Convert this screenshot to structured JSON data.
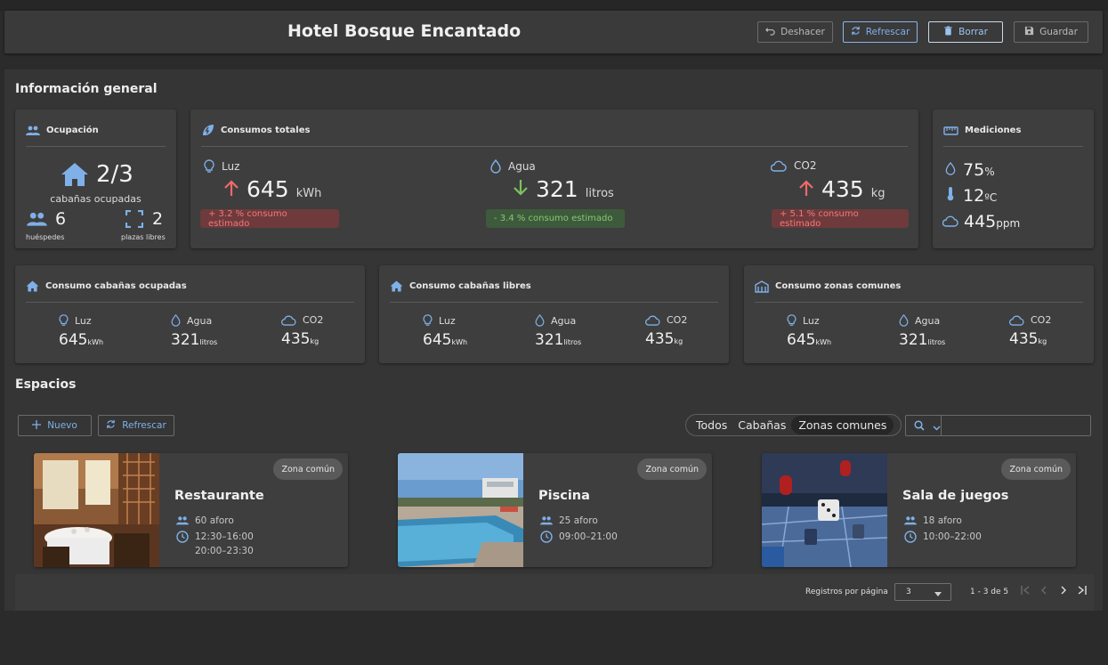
{
  "header": {
    "title": "Hotel Bosque Encantado",
    "buttons": {
      "undo": "Deshacer",
      "refresh": "Refrescar",
      "delete": "Borrar",
      "save": "Guardar"
    }
  },
  "general": {
    "title": "Información general",
    "occupancy": {
      "title": "Ocupación",
      "cabins": "2/3",
      "cabins_label": "cabañas ocupadas",
      "guests": "6",
      "guests_label": "huéspedes",
      "free": "2",
      "free_label": "plazas libres"
    },
    "consumption": {
      "title": "Consumos totales",
      "items": [
        {
          "label": "Luz",
          "value": "645",
          "unit": "kWh",
          "trend": "up",
          "badge": "+ 3.2 % consumo estimado",
          "badge_type": "red"
        },
        {
          "label": "Agua",
          "value": "321",
          "unit": "litros",
          "trend": "down",
          "badge": "- 3.4 % consumo estimado",
          "badge_type": "green"
        },
        {
          "label": "CO2",
          "value": "435",
          "unit": "kg",
          "trend": "up",
          "badge": "+ 5.1 % consumo estimado",
          "badge_type": "red"
        }
      ]
    },
    "measurements": {
      "title": "Mediciones",
      "humidity": "75",
      "humidity_unit": "%",
      "temperature": "12",
      "temperature_unit": "ºC",
      "co2": "445",
      "co2_unit": "ppm"
    },
    "sub_cards": [
      {
        "title": "Consumo cabañas ocupadas",
        "metrics": [
          {
            "label": "Luz",
            "value": "645",
            "unit": "kWh"
          },
          {
            "label": "Agua",
            "value": "321",
            "unit": "litros"
          },
          {
            "label": "CO2",
            "value": "435",
            "unit": "kg"
          }
        ]
      },
      {
        "title": "Consumo cabañas libres",
        "metrics": [
          {
            "label": "Luz",
            "value": "645",
            "unit": "kWh"
          },
          {
            "label": "Agua",
            "value": "321",
            "unit": "litros"
          },
          {
            "label": "CO2",
            "value": "435",
            "unit": "kg"
          }
        ]
      },
      {
        "title": "Consumo zonas comunes",
        "metrics": [
          {
            "label": "Luz",
            "value": "645",
            "unit": "kWh"
          },
          {
            "label": "Agua",
            "value": "321",
            "unit": "litros"
          },
          {
            "label": "CO2",
            "value": "435",
            "unit": "kg"
          }
        ]
      }
    ]
  },
  "spaces": {
    "title": "Espacios",
    "new_label": "Nuevo",
    "refresh_label": "Refrescar",
    "filters": [
      "Todos",
      "Cabañas",
      "Zonas comunes"
    ],
    "active_filter": "Zonas comunes",
    "cards": [
      {
        "chip": "Zona común",
        "name": "Restaurante",
        "capacity": "60 aforo",
        "hours": [
          "12:30–16:00",
          "20:00–23:30"
        ]
      },
      {
        "chip": "Zona común",
        "name": "Piscina",
        "capacity": "25 aforo",
        "hours": [
          "09:00–21:00"
        ]
      },
      {
        "chip": "Zona común",
        "name": "Sala de juegos",
        "capacity": "18 aforo",
        "hours": [
          "10:00–22:00"
        ]
      }
    ]
  },
  "pagination": {
    "rows_label": "Registros por página",
    "rows_value": "3",
    "range": "1 - 3 de 5"
  },
  "colors": {
    "accent": "#7fb0e8",
    "up": "#f06a6a",
    "down": "#7cc25e"
  }
}
